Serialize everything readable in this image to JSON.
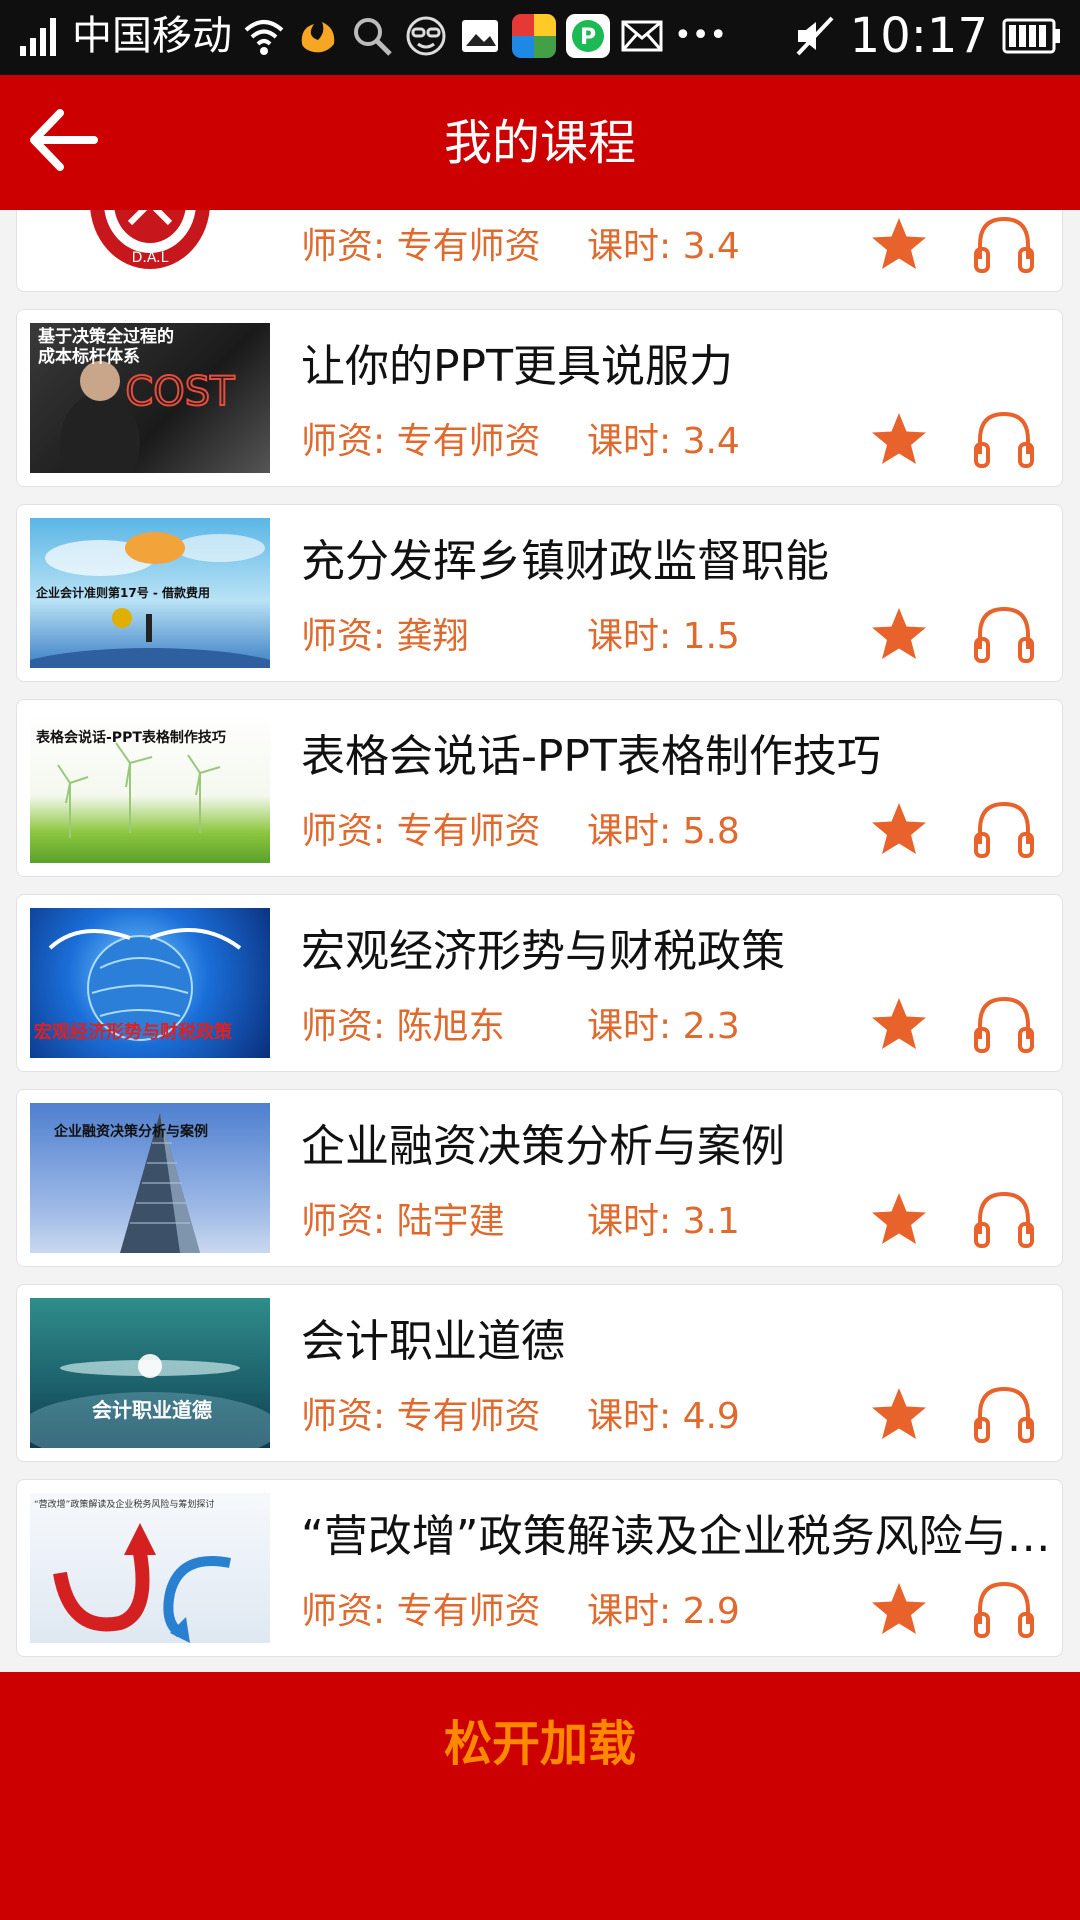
{
  "status_bar": {
    "carrier": "中国移动",
    "time": "10:17",
    "icons": [
      "signal-icon",
      "wifi-icon",
      "uc-browser-icon",
      "search-icon",
      "face-icon",
      "gallery-icon",
      "browser-app-icon",
      "p-app-icon",
      "mail-icon",
      "more-icon",
      "mute-icon",
      "battery-icon"
    ],
    "more": "•••"
  },
  "header": {
    "title": "我的课程",
    "back_icon": "back-arrow-icon"
  },
  "colors": {
    "header_bg": "#cc0000",
    "accent_orange": "#e06a2e",
    "load_text": "#ff8a00",
    "list_bg": "#f3f3f3"
  },
  "courses": [
    {
      "title": "",
      "teacher": "师资: 专有师资",
      "hours": "课时: 3.4",
      "thumb_text": "",
      "thumb_subtext": "D.A.L",
      "thumb": "red-logo"
    },
    {
      "title": "让你的PPT更具说服力",
      "teacher": "师资: 专有师资",
      "hours": "课时: 3.4",
      "thumb_text": "基于决策全过程的成本标杆体系",
      "thumb_subtext": "COST",
      "thumb": "cost-businessman"
    },
    {
      "title": "充分发挥乡镇财政监督职能",
      "teacher": "师资: 龚翔",
      "hours": "课时: 1.5",
      "thumb_text": "企业会计准则第17号 - 借款费用",
      "thumb_subtext": "",
      "thumb": "sky-coin"
    },
    {
      "title": "表格会说话-PPT表格制作技巧",
      "teacher": "师资: 专有师资",
      "hours": "课时: 5.8",
      "thumb_text": "表格会说话-PPT表格制作技巧",
      "thumb_subtext": "",
      "thumb": "wind-turbines"
    },
    {
      "title": "宏观经济形势与财税政策",
      "teacher": "师资: 陈旭东",
      "hours": "课时: 2.3",
      "thumb_text": "宏观经济形势与财税政策",
      "thumb_subtext": "",
      "thumb": "blue-globe"
    },
    {
      "title": "企业融资决策分析与案例",
      "teacher": "师资: 陆宇建",
      "hours": "课时: 3.1",
      "thumb_text": "企业融资决策分析与案例",
      "thumb_subtext": "",
      "thumb": "skyscraper"
    },
    {
      "title": "会计职业道德",
      "teacher": "师资: 专有师资",
      "hours": "课时: 4.9",
      "thumb_text": "会计职业道德",
      "thumb_subtext": "",
      "thumb": "teal-world"
    },
    {
      "title": "“营改增”政策解读及企业税务风险与…",
      "teacher": "师资: 专有师资",
      "hours": "课时: 2.9",
      "thumb_text": "“营改增”政策解读及企业税务风险与筹划探讨",
      "thumb_subtext": "",
      "thumb": "red-blue-arrows"
    }
  ],
  "footer": {
    "load_label": "松开加载"
  }
}
